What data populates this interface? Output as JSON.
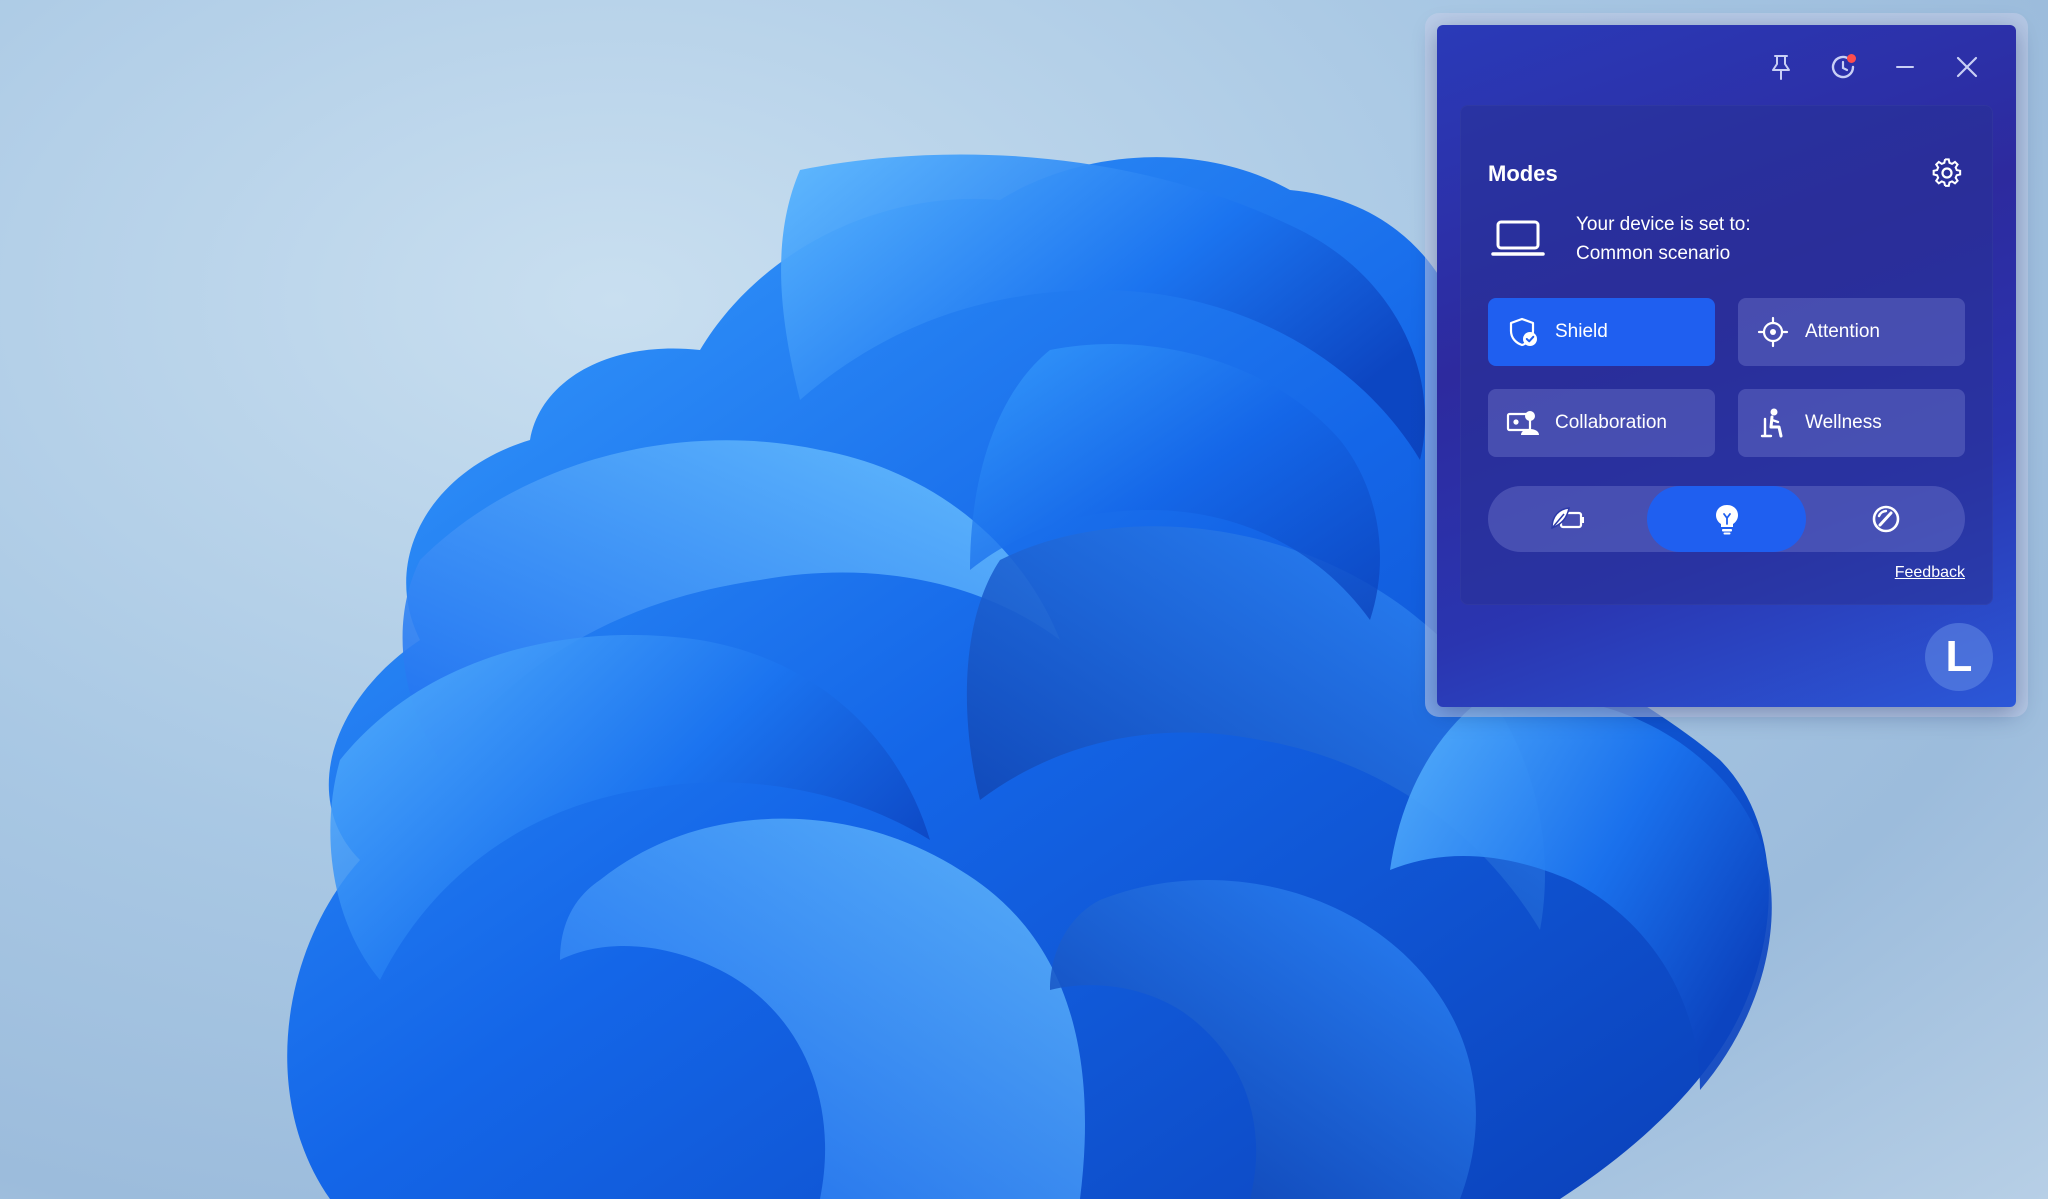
{
  "window": {
    "pin_icon": "pin-icon",
    "refresh_icon": "refresh-icon",
    "minimize_icon": "minimize-icon",
    "close_icon": "close-icon"
  },
  "panel": {
    "title": "Modes",
    "settings_icon": "gear-icon",
    "device": {
      "icon": "laptop-icon",
      "line1": "Your device is set to:",
      "line2": "Common scenario"
    },
    "modes": [
      {
        "label": "Shield",
        "icon": "shield-check-icon",
        "active": true
      },
      {
        "label": "Attention",
        "icon": "crosshair-icon",
        "active": false
      },
      {
        "label": "Collaboration",
        "icon": "presenter-icon",
        "active": false
      },
      {
        "label": "Wellness",
        "icon": "seated-person-icon",
        "active": false
      }
    ],
    "power_segments": [
      {
        "icon": "battery-leaf-icon",
        "active": false
      },
      {
        "icon": "lightbulb-icon",
        "active": true
      },
      {
        "icon": "gauge-icon",
        "active": false
      }
    ],
    "feedback_label": "Feedback"
  },
  "avatar": {
    "initial": "L"
  },
  "colors": {
    "active_button": "#1f5ff0",
    "notification_dot": "#ff4d4d"
  }
}
